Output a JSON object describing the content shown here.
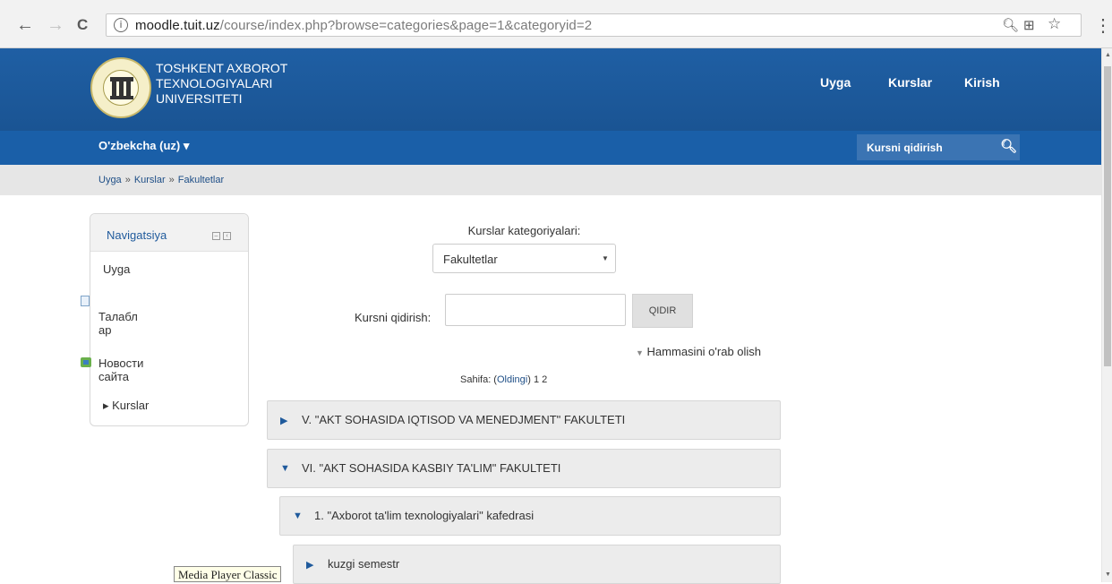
{
  "browser": {
    "url_host": "moodle.tuit.uz",
    "url_path": "/course/index.php?browse=categories&page=1&categoryid=2",
    "back": "←",
    "forward": "→",
    "reload": "C",
    "info": "i",
    "zoom": "🔍︎",
    "translate": "⊞",
    "star": "☆",
    "menu": "⋮"
  },
  "header": {
    "site_name_line1": "TOSHKENT AXBOROT",
    "site_name_line2": "TEXNOLOGIYALARI",
    "site_name_line3": "UNIVERSITETI",
    "nav": [
      "Uyga",
      "Kurslar",
      "Kirish"
    ]
  },
  "subbar": {
    "language": "O'zbekcha (uz) ▾",
    "search_placeholder": "Kursni qidirish",
    "search_icon": "🔍︎"
  },
  "breadcrumb": {
    "items": [
      "Uyga",
      "Kurslar",
      "Fakultetlar"
    ],
    "separator": "»"
  },
  "navigation_block": {
    "title": "Navigatsiya",
    "items": [
      "Uyga",
      "Талабл",
      "ар",
      "Новости",
      "сайта",
      "▸ Kurslar"
    ]
  },
  "main": {
    "category_label": "Kurslar kategoriyalari:",
    "category_selected": "Fakultetlar",
    "search_label": "Kursni qidirish:",
    "search_value": "",
    "search_button": "QIDIR",
    "collapse_all": "Hammasini o'rab olish",
    "pager_prefix": "Sahifa: (",
    "pager_prev": "Oldingi",
    "pager_suffix": ") 1 2"
  },
  "categories": [
    {
      "name": "V. \"AKT SOHASIDA IQTISOD VA MENEDJMENT\" FAKULTETI",
      "expanded": false
    },
    {
      "name": "VI. \"AKT SOHASIDA KASBIY TA'LIM\" FAKULTETI",
      "expanded": true
    },
    {
      "name": "1. \"Axborot ta'lim texnologiyalari\" kafedrasi",
      "expanded": true
    },
    {
      "name": "kuzgi semestr",
      "expanded": false
    }
  ],
  "tooltip": "Media Player Classic",
  "colors": {
    "header_blue": "#1f5fa4",
    "subbar_blue": "#1a5fa8",
    "link_blue": "#1f4f87",
    "category_bg": "#ececec"
  }
}
